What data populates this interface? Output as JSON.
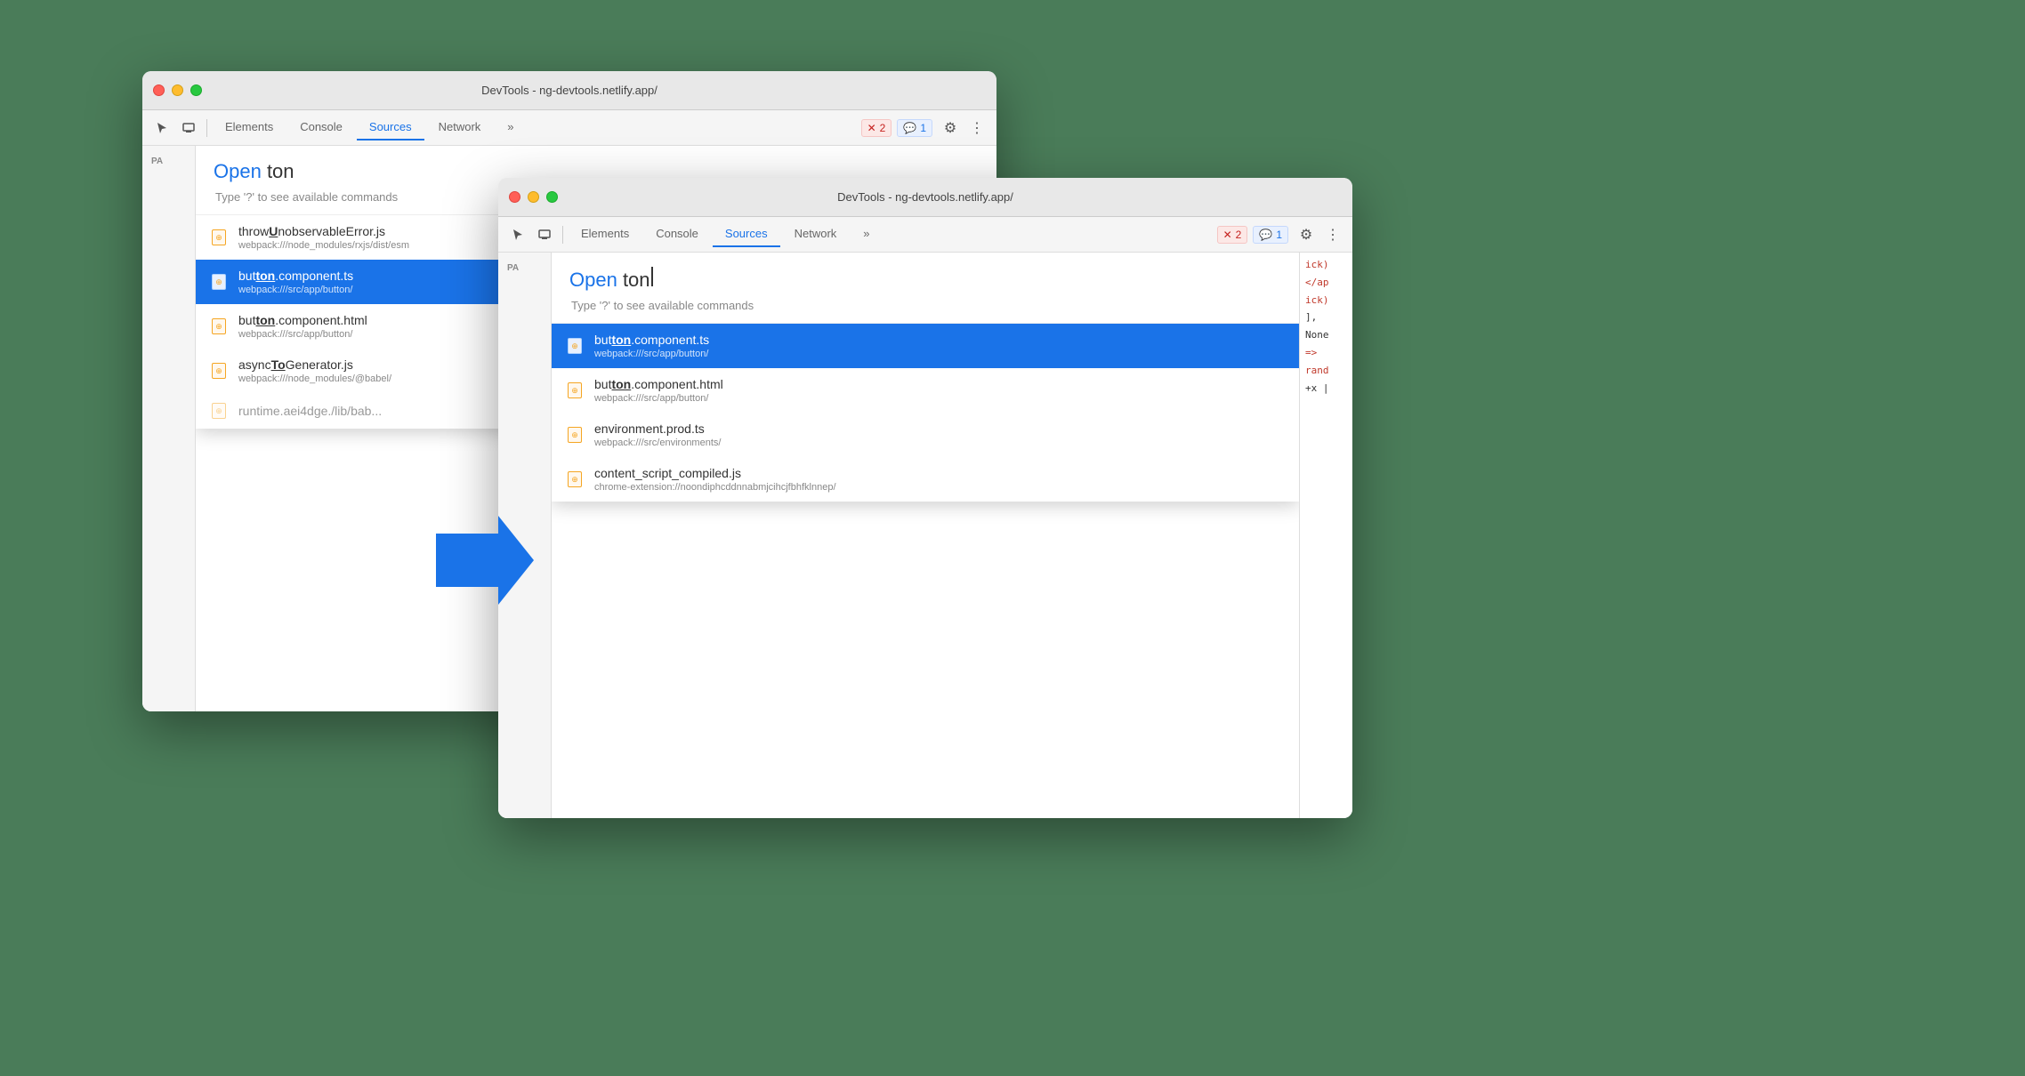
{
  "window_bg": {
    "title": "DevTools - ng-devtools.netlify.app/",
    "tabs": [
      {
        "label": "Elements",
        "active": false
      },
      {
        "label": "Console",
        "active": false
      },
      {
        "label": "Sources",
        "active": true
      },
      {
        "label": "Network",
        "active": false
      },
      {
        "label": "»",
        "active": false
      }
    ],
    "error_count": "2",
    "message_count": "1",
    "command_prefix": "Open",
    "command_text": " ton",
    "command_hint": "Type '?' to see available commands",
    "results": [
      {
        "name": "throwUnobservableError.js",
        "path": "webpack:///node_modules/rxjs/dist/esm",
        "selected": false,
        "name_parts": [
          {
            "text": "t",
            "bold": false
          },
          {
            "text": "h",
            "bold": false
          },
          {
            "text": "row",
            "bold": false
          },
          {
            "text": "U",
            "bold": true
          },
          {
            "text": "nobservableError.js",
            "bold": false
          }
        ]
      },
      {
        "name": "button.component.ts",
        "path": "webpack:///src/app/button/",
        "selected": true,
        "name_parts": [
          {
            "text": "but",
            "bold": false
          },
          {
            "text": "ton",
            "bold": true
          },
          {
            "text": ".component.ts",
            "bold": false
          }
        ]
      },
      {
        "name": "button.component.html",
        "path": "webpack:///src/app/button/",
        "selected": false,
        "name_parts": [
          {
            "text": "but",
            "bold": false
          },
          {
            "text": "ton",
            "bold": true
          },
          {
            "text": ".component.html",
            "bold": false
          }
        ]
      },
      {
        "name": "asyncToGenerator.js",
        "path": "webpack:///node_modules/@babel/",
        "selected": false,
        "name_parts": [
          {
            "text": "async",
            "bold": false
          },
          {
            "text": "To",
            "bold": true
          },
          {
            "text": "Generator.js",
            "bold": false
          }
        ]
      }
    ],
    "sidebar_label": "Pa"
  },
  "window_fg": {
    "title": "DevTools - ng-devtools.netlify.app/",
    "tabs": [
      {
        "label": "Elements",
        "active": false
      },
      {
        "label": "Console",
        "active": false
      },
      {
        "label": "Sources",
        "active": true
      },
      {
        "label": "Network",
        "active": false
      },
      {
        "label": "»",
        "active": false
      }
    ],
    "error_count": "2",
    "message_count": "1",
    "command_prefix": "Open",
    "command_text": " ton",
    "command_hint": "Type '?' to see available commands",
    "results": [
      {
        "name": "button.component.ts",
        "path": "webpack:///src/app/button/",
        "selected": true
      },
      {
        "name": "button.component.html",
        "path": "webpack:///src/app/button/",
        "selected": false
      },
      {
        "name": "environment.prod.ts",
        "path": "webpack:///src/environments/",
        "selected": false
      },
      {
        "name": "content_script_compiled.js",
        "path": "chrome-extension://noondiphcddnnabmjcihcjfbhfklnnep/",
        "selected": false
      }
    ],
    "sidebar_label": "Pa",
    "right_code": [
      "ick)",
      "</ap",
      "ick)",
      "], ",
      "None",
      "=>",
      "rand",
      "+x |"
    ]
  },
  "colors": {
    "accent": "#1a73e8",
    "selected_bg": "#1a73e8",
    "highlight": "#f5a623",
    "arrow": "#1a73e8"
  }
}
